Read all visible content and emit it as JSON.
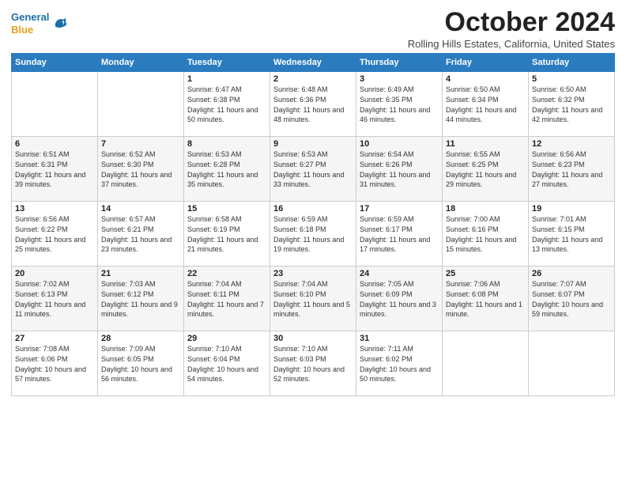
{
  "logo": {
    "line1": "General",
    "line2": "Blue"
  },
  "title": "October 2024",
  "location": "Rolling Hills Estates, California, United States",
  "days_header": [
    "Sunday",
    "Monday",
    "Tuesday",
    "Wednesday",
    "Thursday",
    "Friday",
    "Saturday"
  ],
  "weeks": [
    [
      {
        "day": "",
        "sunrise": "",
        "sunset": "",
        "daylight": ""
      },
      {
        "day": "",
        "sunrise": "",
        "sunset": "",
        "daylight": ""
      },
      {
        "day": "1",
        "sunrise": "Sunrise: 6:47 AM",
        "sunset": "Sunset: 6:38 PM",
        "daylight": "Daylight: 11 hours and 50 minutes."
      },
      {
        "day": "2",
        "sunrise": "Sunrise: 6:48 AM",
        "sunset": "Sunset: 6:36 PM",
        "daylight": "Daylight: 11 hours and 48 minutes."
      },
      {
        "day": "3",
        "sunrise": "Sunrise: 6:49 AM",
        "sunset": "Sunset: 6:35 PM",
        "daylight": "Daylight: 11 hours and 46 minutes."
      },
      {
        "day": "4",
        "sunrise": "Sunrise: 6:50 AM",
        "sunset": "Sunset: 6:34 PM",
        "daylight": "Daylight: 11 hours and 44 minutes."
      },
      {
        "day": "5",
        "sunrise": "Sunrise: 6:50 AM",
        "sunset": "Sunset: 6:32 PM",
        "daylight": "Daylight: 11 hours and 42 minutes."
      }
    ],
    [
      {
        "day": "6",
        "sunrise": "Sunrise: 6:51 AM",
        "sunset": "Sunset: 6:31 PM",
        "daylight": "Daylight: 11 hours and 39 minutes."
      },
      {
        "day": "7",
        "sunrise": "Sunrise: 6:52 AM",
        "sunset": "Sunset: 6:30 PM",
        "daylight": "Daylight: 11 hours and 37 minutes."
      },
      {
        "day": "8",
        "sunrise": "Sunrise: 6:53 AM",
        "sunset": "Sunset: 6:28 PM",
        "daylight": "Daylight: 11 hours and 35 minutes."
      },
      {
        "day": "9",
        "sunrise": "Sunrise: 6:53 AM",
        "sunset": "Sunset: 6:27 PM",
        "daylight": "Daylight: 11 hours and 33 minutes."
      },
      {
        "day": "10",
        "sunrise": "Sunrise: 6:54 AM",
        "sunset": "Sunset: 6:26 PM",
        "daylight": "Daylight: 11 hours and 31 minutes."
      },
      {
        "day": "11",
        "sunrise": "Sunrise: 6:55 AM",
        "sunset": "Sunset: 6:25 PM",
        "daylight": "Daylight: 11 hours and 29 minutes."
      },
      {
        "day": "12",
        "sunrise": "Sunrise: 6:56 AM",
        "sunset": "Sunset: 6:23 PM",
        "daylight": "Daylight: 11 hours and 27 minutes."
      }
    ],
    [
      {
        "day": "13",
        "sunrise": "Sunrise: 6:56 AM",
        "sunset": "Sunset: 6:22 PM",
        "daylight": "Daylight: 11 hours and 25 minutes."
      },
      {
        "day": "14",
        "sunrise": "Sunrise: 6:57 AM",
        "sunset": "Sunset: 6:21 PM",
        "daylight": "Daylight: 11 hours and 23 minutes."
      },
      {
        "day": "15",
        "sunrise": "Sunrise: 6:58 AM",
        "sunset": "Sunset: 6:19 PM",
        "daylight": "Daylight: 11 hours and 21 minutes."
      },
      {
        "day": "16",
        "sunrise": "Sunrise: 6:59 AM",
        "sunset": "Sunset: 6:18 PM",
        "daylight": "Daylight: 11 hours and 19 minutes."
      },
      {
        "day": "17",
        "sunrise": "Sunrise: 6:59 AM",
        "sunset": "Sunset: 6:17 PM",
        "daylight": "Daylight: 11 hours and 17 minutes."
      },
      {
        "day": "18",
        "sunrise": "Sunrise: 7:00 AM",
        "sunset": "Sunset: 6:16 PM",
        "daylight": "Daylight: 11 hours and 15 minutes."
      },
      {
        "day": "19",
        "sunrise": "Sunrise: 7:01 AM",
        "sunset": "Sunset: 6:15 PM",
        "daylight": "Daylight: 11 hours and 13 minutes."
      }
    ],
    [
      {
        "day": "20",
        "sunrise": "Sunrise: 7:02 AM",
        "sunset": "Sunset: 6:13 PM",
        "daylight": "Daylight: 11 hours and 11 minutes."
      },
      {
        "day": "21",
        "sunrise": "Sunrise: 7:03 AM",
        "sunset": "Sunset: 6:12 PM",
        "daylight": "Daylight: 11 hours and 9 minutes."
      },
      {
        "day": "22",
        "sunrise": "Sunrise: 7:04 AM",
        "sunset": "Sunset: 6:11 PM",
        "daylight": "Daylight: 11 hours and 7 minutes."
      },
      {
        "day": "23",
        "sunrise": "Sunrise: 7:04 AM",
        "sunset": "Sunset: 6:10 PM",
        "daylight": "Daylight: 11 hours and 5 minutes."
      },
      {
        "day": "24",
        "sunrise": "Sunrise: 7:05 AM",
        "sunset": "Sunset: 6:09 PM",
        "daylight": "Daylight: 11 hours and 3 minutes."
      },
      {
        "day": "25",
        "sunrise": "Sunrise: 7:06 AM",
        "sunset": "Sunset: 6:08 PM",
        "daylight": "Daylight: 11 hours and 1 minute."
      },
      {
        "day": "26",
        "sunrise": "Sunrise: 7:07 AM",
        "sunset": "Sunset: 6:07 PM",
        "daylight": "Daylight: 10 hours and 59 minutes."
      }
    ],
    [
      {
        "day": "27",
        "sunrise": "Sunrise: 7:08 AM",
        "sunset": "Sunset: 6:06 PM",
        "daylight": "Daylight: 10 hours and 57 minutes."
      },
      {
        "day": "28",
        "sunrise": "Sunrise: 7:09 AM",
        "sunset": "Sunset: 6:05 PM",
        "daylight": "Daylight: 10 hours and 56 minutes."
      },
      {
        "day": "29",
        "sunrise": "Sunrise: 7:10 AM",
        "sunset": "Sunset: 6:04 PM",
        "daylight": "Daylight: 10 hours and 54 minutes."
      },
      {
        "day": "30",
        "sunrise": "Sunrise: 7:10 AM",
        "sunset": "Sunset: 6:03 PM",
        "daylight": "Daylight: 10 hours and 52 minutes."
      },
      {
        "day": "31",
        "sunrise": "Sunrise: 7:11 AM",
        "sunset": "Sunset: 6:02 PM",
        "daylight": "Daylight: 10 hours and 50 minutes."
      },
      {
        "day": "",
        "sunrise": "",
        "sunset": "",
        "daylight": ""
      },
      {
        "day": "",
        "sunrise": "",
        "sunset": "",
        "daylight": ""
      }
    ]
  ]
}
